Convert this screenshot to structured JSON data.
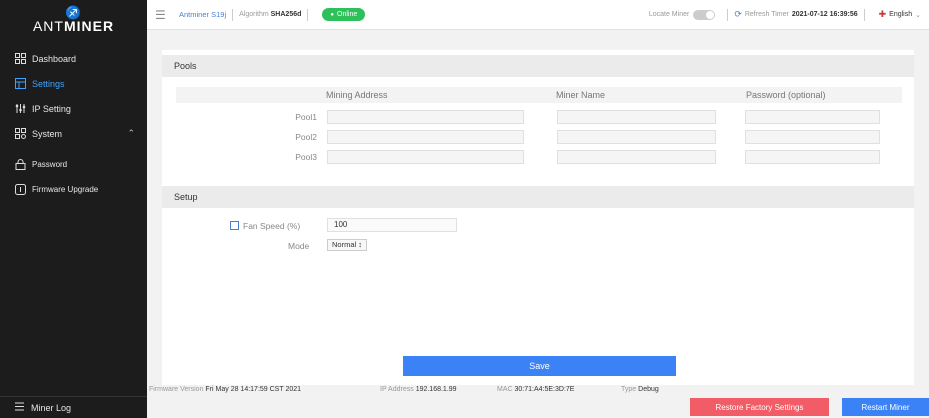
{
  "brand": {
    "logo_mark": "♐",
    "logo_prefix": "ANT",
    "logo_suffix": "MINER"
  },
  "sidebar": {
    "items": [
      {
        "label": "Dashboard",
        "icon": "grid-icon"
      },
      {
        "label": "Settings",
        "icon": "settings-icon",
        "active": true
      },
      {
        "label": "IP Setting",
        "icon": "network-icon"
      },
      {
        "label": "System",
        "icon": "system-icon",
        "expanded": true
      },
      {
        "label": "Password",
        "icon": "lock-icon"
      },
      {
        "label": "Firmware Upgrade",
        "icon": "upgrade-icon"
      }
    ],
    "footer_label": "Miner Log"
  },
  "header": {
    "miner_model": "Antminer S19j",
    "algorithm_label": "Algorithm",
    "algorithm_value": "SHA256d",
    "status": "Online",
    "locate_label": "Locate Miner",
    "refresh_label": "Refresh Timer",
    "refresh_value": "2021-07-12 16:39:56",
    "language": "English",
    "status_color": "#2ec15a"
  },
  "pools": {
    "title": "Pools",
    "columns": [
      "Mining Address",
      "Miner Name",
      "Password (optional)"
    ],
    "rows": [
      {
        "label": "Pool1",
        "address": "",
        "name": "",
        "password": ""
      },
      {
        "label": "Pool2",
        "address": "",
        "name": "",
        "password": ""
      },
      {
        "label": "Pool3",
        "address": "",
        "name": "",
        "password": ""
      }
    ]
  },
  "setup": {
    "title": "Setup",
    "fan_label": "Fan Speed (%)",
    "fan_value": "100",
    "mode_label": "Mode",
    "mode_value": "Normal ↕"
  },
  "actions": {
    "save": "Save",
    "restore": "Restore Factory Settings",
    "restart": "Restart Miner"
  },
  "footer": {
    "firmware_label": "Firmware Version",
    "firmware_value": "Fri May 28 14:17:59 CST 2021",
    "ip_label": "IP Address",
    "ip_value": "192.168.1.99",
    "mac_label": "MAC",
    "mac_value": "30:71:A4:5E:3D:7E",
    "type_label": "Type",
    "type_value": "Debug"
  },
  "colors": {
    "accent": "#3b82f6",
    "danger": "#f25c66",
    "sidebar_bg": "#1c1c1c"
  }
}
